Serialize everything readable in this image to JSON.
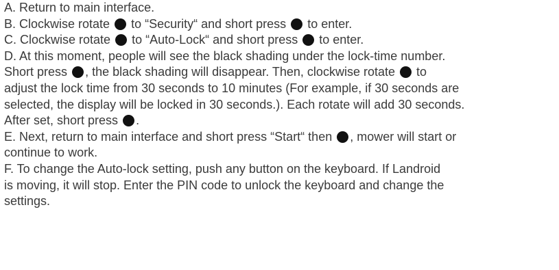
{
  "steps": {
    "a": "A. Return to main interface.",
    "b1": "B. Clockwise rotate",
    "b2": "to “Security“ and short press",
    "b3": "to enter.",
    "c1": "C. Clockwise rotate",
    "c2": "to “Auto-Lock“ and short press",
    "c3": "to enter.",
    "d_line1": "D. At this moment, people will see the black shading under the lock-time number.",
    "d_line2a": "Short press",
    "d_line2b": ", the black shading will disappear. Then, clockwise rotate",
    "d_line2c": "to",
    "d_line3": "adjust the lock time from 30 seconds to 10 minutes (For example, if 30 seconds are",
    "d_line4": "selected, the display will be locked in 30 seconds.). Each rotate will add 30 seconds.",
    "d_line5a": "After set,  short press",
    "d_line5b": ".",
    "e_line1a": "E. Next, return to main interface and short press “Start“ then",
    "e_line1b": ", mower will start or",
    "e_line2": "continue to work.",
    "f_line1": "F. To change the Auto-lock setting, push any button on the keyboard. If Landroid",
    "f_line2": "is moving, it will stop. Enter the PIN code to unlock the keyboard and change the",
    "f_line3": "settings."
  },
  "icons": {
    "dial": "control-dial-icon",
    "dial_color": "#111111"
  },
  "colors": {
    "text": "#3a3a3a",
    "background": "#ffffff"
  }
}
